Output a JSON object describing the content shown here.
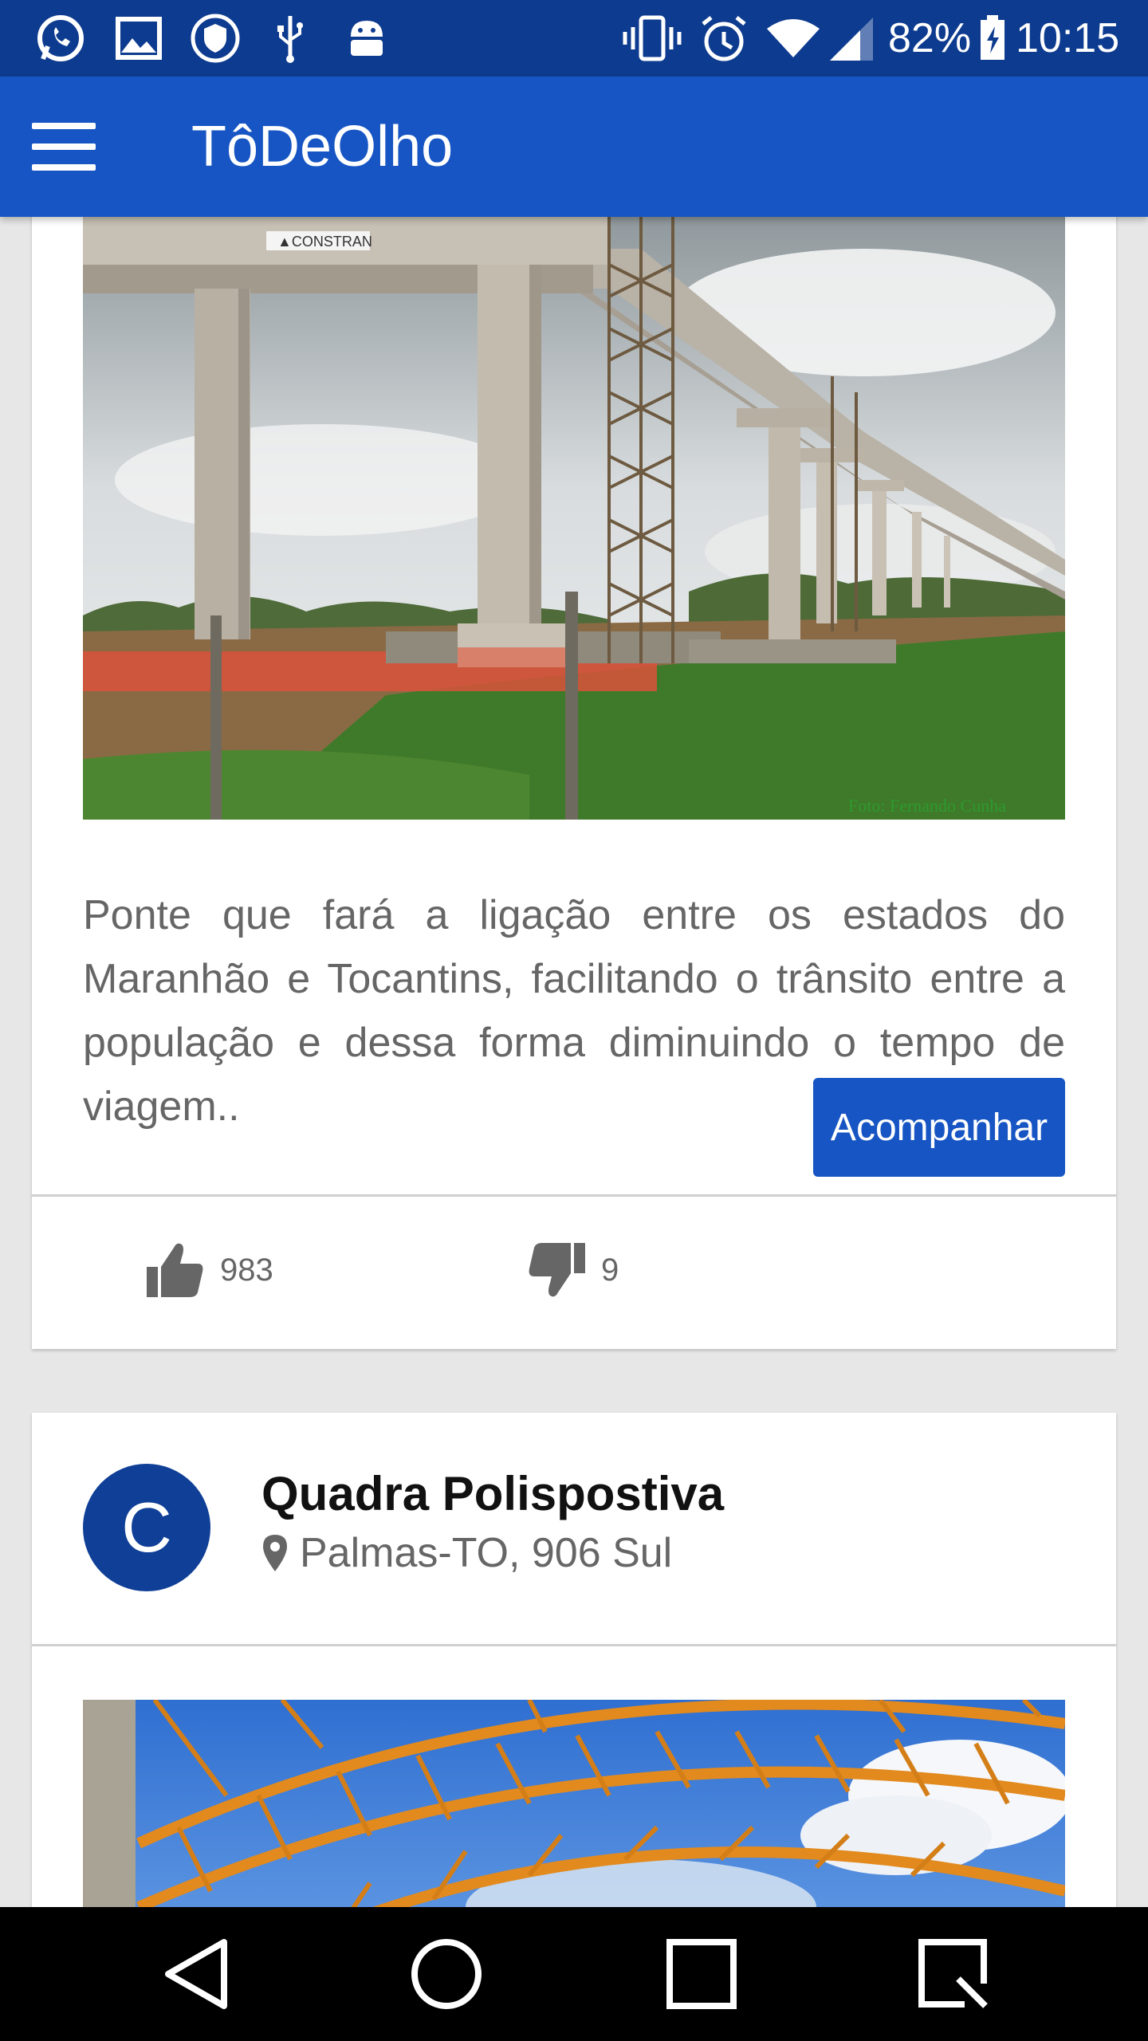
{
  "status_bar": {
    "battery_percent": "82%",
    "time": "10:15",
    "left_icons": [
      "whatsapp-icon",
      "gallery-icon",
      "shield-icon",
      "usb-icon",
      "android-debug-icon"
    ],
    "right_icons": [
      "vibrate-icon",
      "alarm-icon",
      "wifi-icon",
      "signal-icon",
      "battery-charging-icon"
    ]
  },
  "app_bar": {
    "title": "TôDeOlho",
    "menu_icon": "hamburger-menu-icon",
    "color": "#1655c3"
  },
  "cards": [
    {
      "image_description": "bridge-construction-photo",
      "image_watermark": "Foto: Fernando Cunha",
      "image_sign": "CONSTRAN",
      "description": "Ponte que fará a ligação entre os estados do Maranhão e Tocantins, facilitando o trânsito entre a população e dessa forma diminuindo o tempo de viagem..",
      "follow_label": "Acompanhar",
      "likes": "983",
      "dislikes": "9"
    },
    {
      "avatar_letter": "C",
      "title": "Quadra Polispostiva",
      "location": "Palmas-TO, 906 Sul",
      "image_description": "sports-court-roof-structure-photo"
    }
  ],
  "nav_bar": {
    "buttons": [
      "back-icon",
      "home-icon",
      "recents-icon",
      "screenshot-icon"
    ]
  },
  "colors": {
    "status_bar": "#0d3b8f",
    "accent": "#1655c3",
    "avatar": "#0f3f96",
    "background": "#e7e7e7"
  }
}
